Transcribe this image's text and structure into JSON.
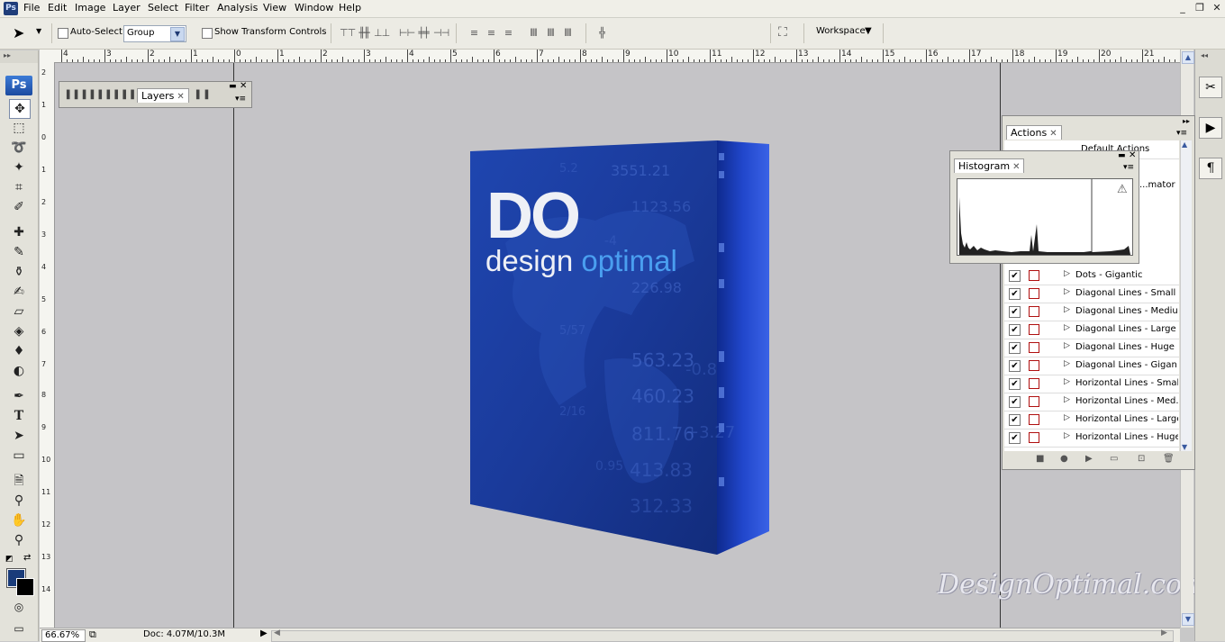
{
  "app_icon": "Ps",
  "menu": [
    "File",
    "Edit",
    "Image",
    "Layer",
    "Select",
    "Filter",
    "Analysis",
    "View",
    "Window",
    "Help"
  ],
  "window_controls": {
    "minimize": "_",
    "restore": "❐",
    "close": "✕"
  },
  "options_bar": {
    "auto_select_label": "Auto-Select:",
    "auto_select_checked": false,
    "group_value": "Group",
    "show_transform_label": "Show Transform Controls",
    "show_transform_checked": false,
    "workspace_label": "Workspace"
  },
  "toolbox": {
    "logo": "Ps",
    "tools": [
      "move-tool",
      "marquee-tool",
      "lasso-tool",
      "magic-wand-tool",
      "crop-tool",
      "slice-tool",
      "healing-brush-tool",
      "brush-tool",
      "clone-stamp-tool",
      "history-brush-tool",
      "eraser-tool",
      "paint-bucket-tool",
      "blur-tool",
      "dodge-tool",
      "pen-tool",
      "type-tool",
      "path-selection-tool",
      "shape-tool",
      "notes-tool",
      "eyedropper-tool",
      "hand-tool",
      "zoom-tool"
    ],
    "type_tool_glyph": "T",
    "foreground_color": "#1a3c7a",
    "background_color": "#000000"
  },
  "ruler_top": [
    "4",
    "3",
    "2",
    "1",
    "0",
    "1",
    "2",
    "3",
    "4",
    "5",
    "6",
    "7",
    "8",
    "9",
    "10",
    "11",
    "12",
    "13",
    "14",
    "15",
    "16",
    "17",
    "18",
    "19",
    "20",
    "21"
  ],
  "ruler_left": [
    "2",
    "1",
    "0",
    "1",
    "2",
    "3",
    "4",
    "5",
    "6",
    "7",
    "8",
    "9",
    "10",
    "11",
    "12",
    "13",
    "14"
  ],
  "layers_panel": {
    "tab_label": "Layers"
  },
  "box_art": {
    "logo_big": "DO",
    "logo_word1": "design",
    "logo_word2": "optimal",
    "bg_numbers": [
      "3551.21",
      "1123.56",
      "226.98",
      "563.23",
      "460.23",
      "811.76",
      "413.83",
      "312.33",
      "+3.27",
      "-0.8",
      "0.95",
      "2/16",
      "5/57",
      "-4",
      "5.2"
    ],
    "accent_color": "#4a9ff0",
    "box_color": "#1b3ea6"
  },
  "watermark": "DesignOptimal.com",
  "status": {
    "zoom": "66.67%",
    "doc": "Doc: 4.07M/10.3M"
  },
  "actions_panel": {
    "tab_label": "Actions",
    "partial_rows": [
      "Default Actions",
      "...mator"
    ],
    "rows": [
      "Dots - Gigantic",
      "Diagonal Lines - Small",
      "Diagonal Lines - Medium",
      "Diagonal Lines - Large",
      "Diagonal Lines - Huge",
      "Diagonal Lines - Gigan...",
      "Horizontal Lines - Small",
      "Horizontal Lines - Med...",
      "Horizontal Lines - Large",
      "Horizontal Lines - Huge"
    ],
    "check_glyph": "✔"
  },
  "histogram_panel": {
    "tab_label": "Histogram",
    "warning_glyph": "⚠"
  }
}
